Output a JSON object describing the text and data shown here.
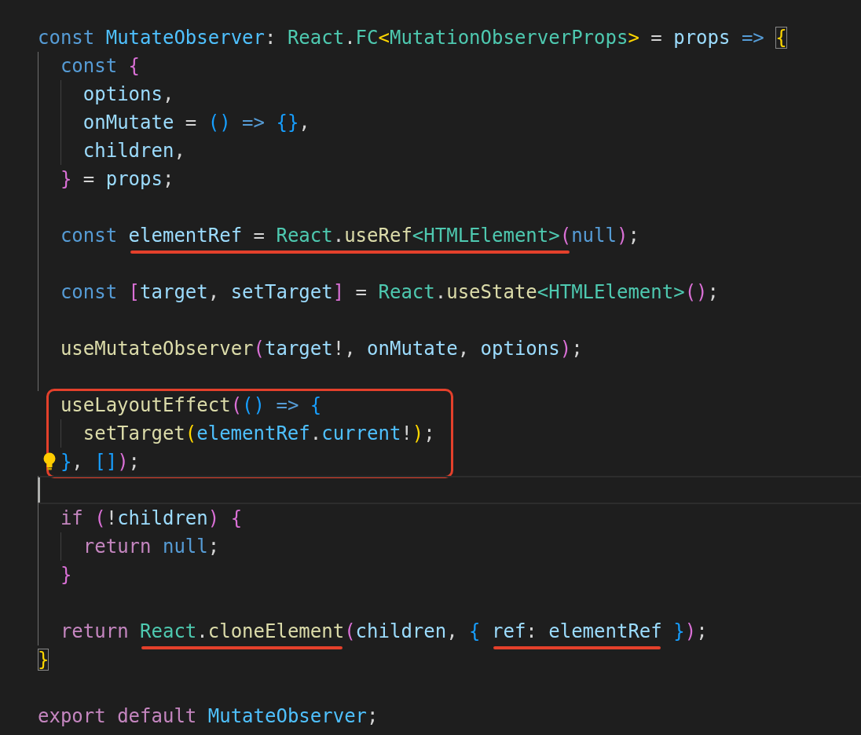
{
  "lines": [
    {
      "kind": "code",
      "current": false,
      "tokens": [
        {
          "text": "const ",
          "kind": "kw"
        },
        {
          "text": "MutateObserver",
          "kind": "cst"
        },
        {
          "text": ": ",
          "kind": "p"
        },
        {
          "text": "React",
          "kind": "type"
        },
        {
          "text": ".",
          "kind": "p"
        },
        {
          "text": "FC",
          "kind": "type"
        },
        {
          "text": "<",
          "kind": "b1"
        },
        {
          "text": "MutationObserverProps",
          "kind": "type"
        },
        {
          "text": ">",
          "kind": "b1"
        },
        {
          "text": " = ",
          "kind": "p"
        },
        {
          "text": "props ",
          "kind": "var"
        },
        {
          "text": "=> ",
          "kind": "kw"
        },
        {
          "text": "{",
          "kind": "b1m"
        }
      ]
    },
    {
      "kind": "code",
      "current": false,
      "tokens": [
        {
          "text": "  const ",
          "kind": "kw"
        },
        {
          "text": "{",
          "kind": "b2"
        }
      ]
    },
    {
      "kind": "code",
      "current": false,
      "tokens": [
        {
          "text": "    options",
          "kind": "var"
        },
        {
          "text": ",",
          "kind": "p"
        }
      ]
    },
    {
      "kind": "code",
      "current": false,
      "tokens": [
        {
          "text": "    onMutate",
          "kind": "var"
        },
        {
          "text": " = ",
          "kind": "p"
        },
        {
          "text": "() ",
          "kind": "b3"
        },
        {
          "text": "=> ",
          "kind": "kw"
        },
        {
          "text": "{}",
          "kind": "b3"
        },
        {
          "text": ",",
          "kind": "p"
        }
      ]
    },
    {
      "kind": "code",
      "current": false,
      "tokens": [
        {
          "text": "    children",
          "kind": "var"
        },
        {
          "text": ",",
          "kind": "p"
        }
      ]
    },
    {
      "kind": "code",
      "current": false,
      "tokens": [
        {
          "text": "  }",
          "kind": "b2"
        },
        {
          "text": " = ",
          "kind": "p"
        },
        {
          "text": "props",
          "kind": "var"
        },
        {
          "text": ";",
          "kind": "p"
        }
      ]
    },
    {
      "kind": "blank",
      "current": false
    },
    {
      "kind": "code",
      "current": false,
      "tokens": [
        {
          "text": "  const ",
          "kind": "kw"
        },
        {
          "kind": "underlined",
          "tokens": [
            {
              "text": "elementRef",
              "kind": "var"
            },
            {
              "text": " = ",
              "kind": "p"
            },
            {
              "text": "React",
              "kind": "type"
            },
            {
              "text": ".",
              "kind": "p"
            },
            {
              "text": "useRef",
              "kind": "fn"
            },
            {
              "text": "<HTMLElement>",
              "kind": "type"
            },
            {
              "text": "(",
              "kind": "b2"
            }
          ]
        },
        {
          "text": "null",
          "kind": "kw"
        },
        {
          "text": ")",
          "kind": "b2"
        },
        {
          "text": ";",
          "kind": "p"
        }
      ]
    },
    {
      "kind": "blank",
      "current": false
    },
    {
      "kind": "code",
      "current": false,
      "tokens": [
        {
          "text": "  const ",
          "kind": "kw"
        },
        {
          "text": "[",
          "kind": "b2"
        },
        {
          "text": "target",
          "kind": "var"
        },
        {
          "text": ", ",
          "kind": "p"
        },
        {
          "text": "setTarget",
          "kind": "var"
        },
        {
          "text": "]",
          "kind": "b2"
        },
        {
          "text": " = ",
          "kind": "p"
        },
        {
          "text": "React",
          "kind": "type"
        },
        {
          "text": ".",
          "kind": "p"
        },
        {
          "text": "useState",
          "kind": "fn"
        },
        {
          "text": "<HTMLElement>",
          "kind": "type"
        },
        {
          "text": "()",
          "kind": "b2"
        },
        {
          "text": ";",
          "kind": "p"
        }
      ]
    },
    {
      "kind": "blank",
      "current": false
    },
    {
      "kind": "code",
      "current": false,
      "tokens": [
        {
          "text": "  useMutateObserver",
          "kind": "fn"
        },
        {
          "text": "(",
          "kind": "b2"
        },
        {
          "text": "target",
          "kind": "var"
        },
        {
          "text": "!, ",
          "kind": "p"
        },
        {
          "text": "onMutate",
          "kind": "var"
        },
        {
          "text": ", ",
          "kind": "p"
        },
        {
          "text": "options",
          "kind": "var"
        },
        {
          "text": ")",
          "kind": "b2"
        },
        {
          "text": ";",
          "kind": "p"
        }
      ]
    },
    {
      "kind": "blank",
      "current": false
    },
    {
      "kind": "boxed_group",
      "lines": [
        {
          "kind": "code",
          "current": false,
          "tokens": [
            {
              "text": "  useLayoutEffect",
              "kind": "fn"
            },
            {
              "text": "(",
              "kind": "b2"
            },
            {
              "text": "() ",
              "kind": "b3"
            },
            {
              "text": "=> ",
              "kind": "kw"
            },
            {
              "text": "{",
              "kind": "b3"
            }
          ]
        },
        {
          "kind": "code",
          "current": false,
          "tokens": [
            {
              "text": "    setTarget",
              "kind": "fn"
            },
            {
              "text": "(",
              "kind": "b1"
            },
            {
              "text": "elementRef",
              "kind": "cst"
            },
            {
              "text": ".",
              "kind": "p"
            },
            {
              "text": "current",
              "kind": "cst"
            },
            {
              "text": "!",
              "kind": "p"
            },
            {
              "text": ")",
              "kind": "b1"
            },
            {
              "text": ";",
              "kind": "p"
            }
          ]
        },
        {
          "kind": "code",
          "current": false,
          "lightbulb": true,
          "tokens": [
            {
              "text": "  }",
              "kind": "b3"
            },
            {
              "text": ", ",
              "kind": "p"
            },
            {
              "text": "[]",
              "kind": "b3"
            },
            {
              "text": ")",
              "kind": "b2"
            },
            {
              "text": ";",
              "kind": "p"
            }
          ]
        }
      ]
    },
    {
      "kind": "blank",
      "current": true
    },
    {
      "kind": "code",
      "current": false,
      "tokens": [
        {
          "text": "  if ",
          "kind": "ctl"
        },
        {
          "text": "(",
          "kind": "b2"
        },
        {
          "text": "!",
          "kind": "p"
        },
        {
          "text": "children",
          "kind": "var"
        },
        {
          "text": ") ",
          "kind": "b2"
        },
        {
          "text": "{",
          "kind": "b2"
        }
      ]
    },
    {
      "kind": "code",
      "current": false,
      "tokens": [
        {
          "text": "    return ",
          "kind": "ctl"
        },
        {
          "text": "null",
          "kind": "kw"
        },
        {
          "text": ";",
          "kind": "p"
        }
      ]
    },
    {
      "kind": "code",
      "current": false,
      "tokens": [
        {
          "text": "  }",
          "kind": "b2"
        }
      ]
    },
    {
      "kind": "blank",
      "current": false
    },
    {
      "kind": "code",
      "current": false,
      "tokens": [
        {
          "text": "  return ",
          "kind": "ctl"
        },
        {
          "kind": "underlined",
          "tokens": [
            {
              "text": "React",
              "kind": "type"
            },
            {
              "text": ".",
              "kind": "p"
            },
            {
              "text": "cloneElement",
              "kind": "fn"
            }
          ]
        },
        {
          "text": "(",
          "kind": "b2"
        },
        {
          "text": "children",
          "kind": "var"
        },
        {
          "text": ", ",
          "kind": "p"
        },
        {
          "text": "{ ",
          "kind": "b3"
        },
        {
          "kind": "underlined",
          "tokens": [
            {
              "text": "ref",
              "kind": "var"
            },
            {
              "text": ": ",
              "kind": "p"
            },
            {
              "text": "elementRef",
              "kind": "var"
            }
          ]
        },
        {
          "text": " }",
          "kind": "b3"
        },
        {
          "text": ")",
          "kind": "b2"
        },
        {
          "text": ";",
          "kind": "p"
        }
      ]
    },
    {
      "kind": "code",
      "current": false,
      "tokens": [
        {
          "text": "}",
          "kind": "b1m"
        }
      ]
    },
    {
      "kind": "blank",
      "current": false
    },
    {
      "kind": "code",
      "current": false,
      "tokens": [
        {
          "text": "export ",
          "kind": "ctl"
        },
        {
          "text": "default ",
          "kind": "ctl"
        },
        {
          "text": "MutateObserver",
          "kind": "cst"
        },
        {
          "text": ";",
          "kind": "p"
        }
      ]
    }
  ]
}
